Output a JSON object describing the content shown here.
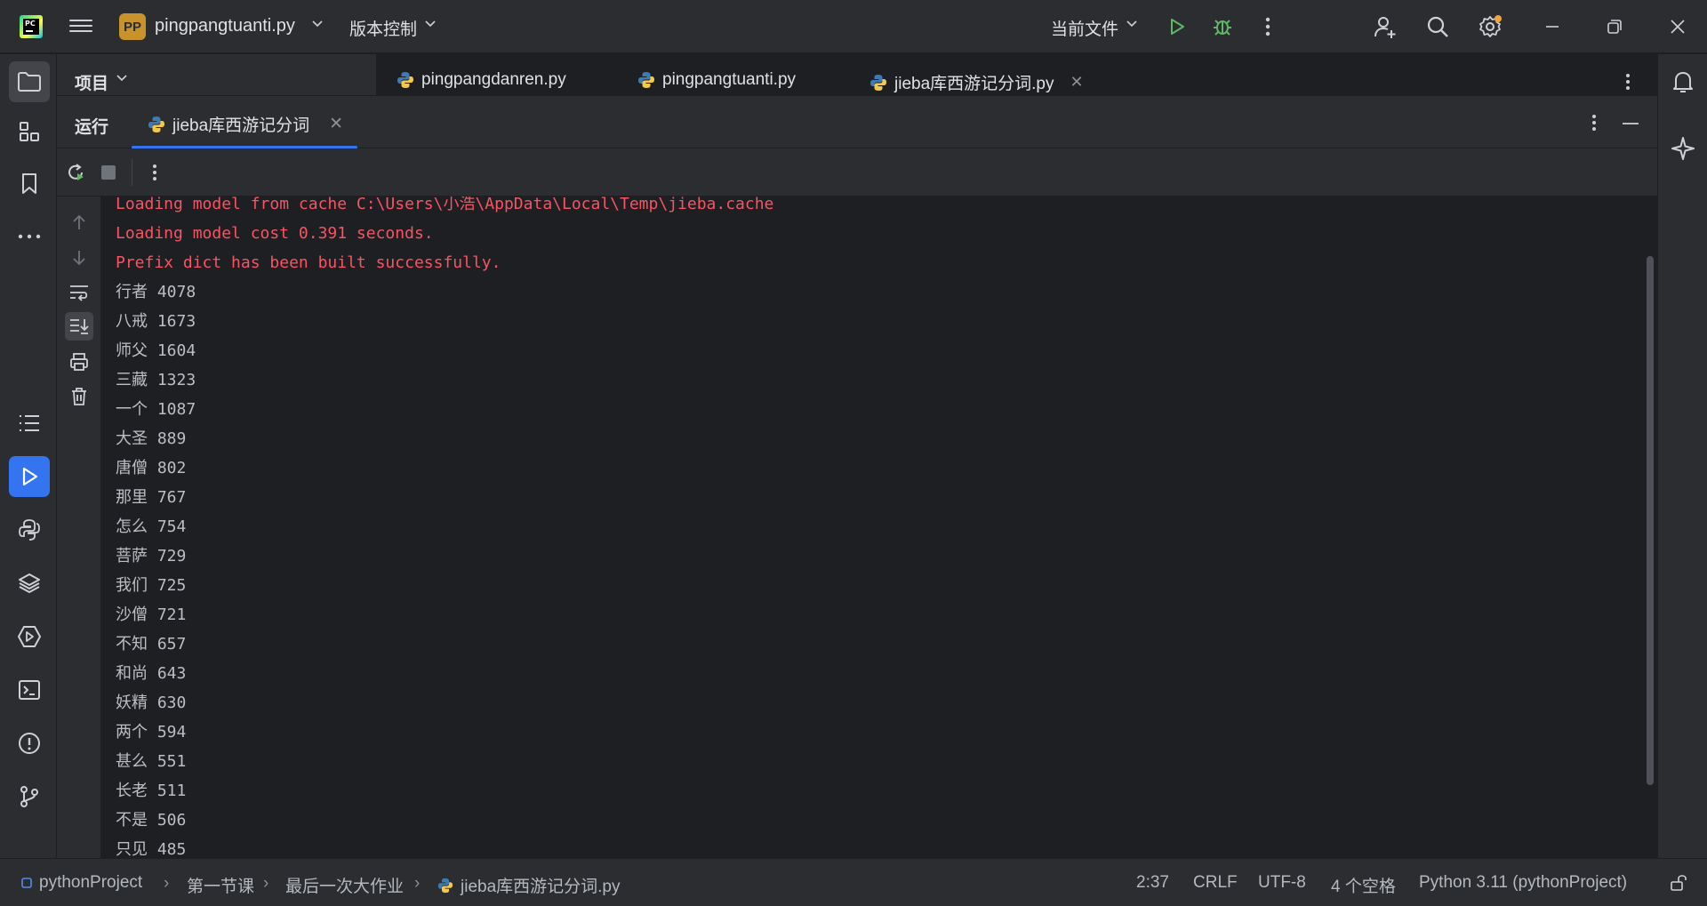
{
  "titlebar": {
    "project_badge": "PP",
    "project_name": "pingpangtuanti.py",
    "vcs_label": "版本控制",
    "run_config_label": "当前文件"
  },
  "project_panel": {
    "label": "项目"
  },
  "editor_tabs": [
    {
      "label": "pingpangdanren.py"
    },
    {
      "label": "pingpangtuanti.py"
    },
    {
      "label": "jieba库西游记分词.py"
    }
  ],
  "run_panel": {
    "title": "运行",
    "tab_label": "jieba库西游记分词"
  },
  "console": {
    "lines": [
      "Loading model from cache C:\\Users\\小浩\\AppData\\Local\\Temp\\jieba.cache",
      "Loading model cost 0.391 seconds.",
      "Prefix dict has been built successfully.",
      "行者 4078",
      "八戒 1673",
      "师父 1604",
      "三藏 1323",
      "一个 1087",
      "大圣 889",
      "唐僧 802",
      "那里 767",
      "怎么 754",
      "菩萨 729",
      "我们 725",
      "沙僧 721",
      "不知 657",
      "和尚 643",
      "妖精 630",
      "两个 594",
      "甚么 551",
      "长老 511",
      "不是 506",
      "只见 485"
    ]
  },
  "statusbar": {
    "breadcrumb": [
      "pythonProject",
      "第一节课",
      "最后一次大作业",
      "jieba库西游记分词.py"
    ],
    "position": "2:37",
    "line_ending": "CRLF",
    "encoding": "UTF-8",
    "indent": "4 个空格",
    "interpreter": "Python 3.11 (pythonProject)"
  },
  "colors": {
    "accent": "#3574f0",
    "error_text": "#f75464",
    "run_green": "#5fb865",
    "badge": "#c9932b"
  },
  "icons": {
    "titlebar": [
      "pycharm-logo",
      "hamburger-menu-icon",
      "chevron-down-icon",
      "run-icon",
      "debug-icon",
      "more-icon",
      "add-user-icon",
      "search-icon",
      "settings-icon",
      "minimize-icon",
      "restore-icon",
      "close-icon"
    ],
    "left_toolbar": [
      "folder-icon",
      "structure-icon",
      "bookmark-icon",
      "more-horizontal-icon",
      "list-icon",
      "run-panel-icon",
      "python-console-icon",
      "layers-icon",
      "services-icon",
      "terminal-icon",
      "problems-icon",
      "git-icon"
    ],
    "right_toolbar": [
      "notifications-icon",
      "ai-assistant-icon"
    ]
  }
}
